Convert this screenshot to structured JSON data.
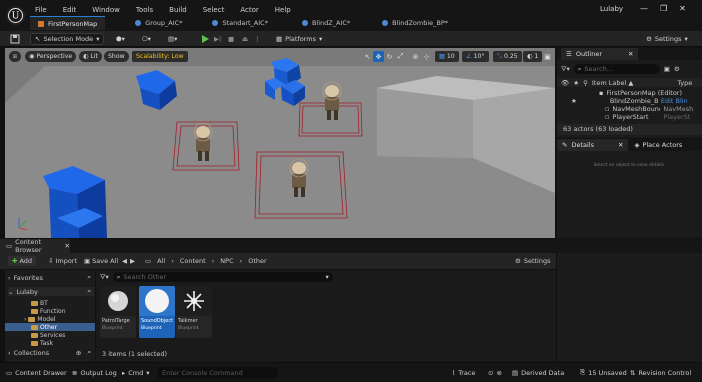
{
  "menu": [
    "File",
    "Edit",
    "Window",
    "Tools",
    "Build",
    "Select",
    "Actor",
    "Help"
  ],
  "project_name": "Lulaby",
  "tabs": [
    {
      "label": "FirstPersonMap",
      "active": true
    },
    {
      "label": "Group_AIC*",
      "active": false
    },
    {
      "label": "Standart_AIC*",
      "active": false
    },
    {
      "label": "BlindZ_AIC*",
      "active": false
    },
    {
      "label": "BlindZombie_BP*",
      "active": false
    }
  ],
  "toolbar": {
    "selection_mode": "Selection Mode",
    "platforms": "Platforms",
    "settings": "Settings"
  },
  "viewport": {
    "perspective": "Perspective",
    "lit": "Lit",
    "show": "Show",
    "scalability": "Scalability: Low",
    "grid_snap": "10",
    "rot_snap": "10°",
    "scale_snap": "0.25",
    "camera_speed": "1"
  },
  "outliner": {
    "title": "Outliner",
    "search_placeholder": "Search...",
    "col_label": "Item Label ▲",
    "col_type": "Type",
    "rows": [
      {
        "label": "FirstPersonMap (Editor)",
        "type": ""
      },
      {
        "label": "BlindZombie_BP",
        "type": "Edit Blin"
      },
      {
        "label": "NavMeshBound",
        "type": "NavMesh"
      },
      {
        "label": "PlayerStart",
        "type": "PlayerSt"
      }
    ],
    "count": "63 actors (63 loaded)"
  },
  "details": {
    "tab_details": "Details",
    "tab_place": "Place Actors",
    "empty_msg": "Select an object to view details."
  },
  "content_browser": {
    "title": "Content Browser",
    "add": "Add",
    "import": "Import",
    "save_all": "Save All",
    "path": [
      "All",
      "Content",
      "NPC",
      "Other"
    ],
    "settings": "Settings",
    "favorites": "Favorites",
    "project": "Lulaby",
    "folders": [
      "BT",
      "Function",
      "Model",
      "Other",
      "Services",
      "Task"
    ],
    "selected_folder": "Other",
    "collections": "Collections",
    "search_placeholder": "Search Other",
    "assets": [
      {
        "name": "PatrolTarge",
        "type": "Blueprint"
      },
      {
        "name": "SoundObject",
        "type": "Blueprint"
      },
      {
        "name": "Talkmer",
        "type": "Blueprint"
      }
    ],
    "selection_info": "3 items (1 selected)"
  },
  "statusbar": {
    "content_drawer": "Content Drawer",
    "output_log": "Output Log",
    "cmd": "Cmd",
    "console_placeholder": "Enter Console Command",
    "trace": "Trace",
    "derived_data": "Derived Data",
    "unsaved": "15 Unsaved",
    "revision": "Revision Control"
  },
  "colors": {
    "accent": "#1d64b8",
    "scalability": "#f2c218",
    "play_green": "#5fbf4a",
    "cube_blue": "#1f64e0"
  }
}
